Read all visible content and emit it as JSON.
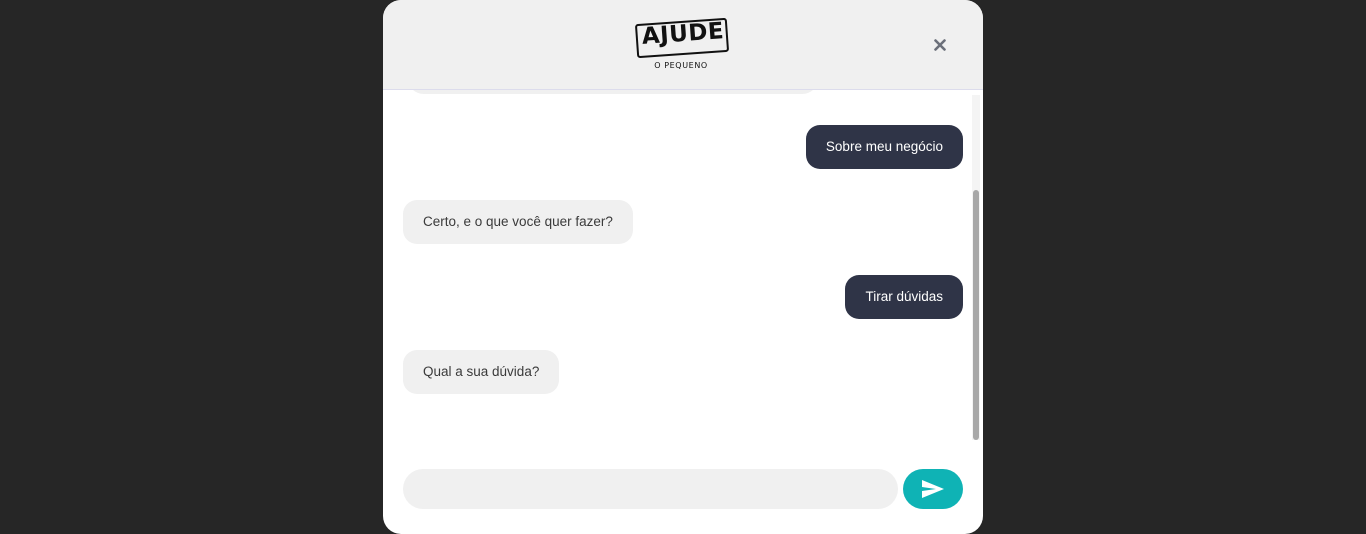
{
  "header": {
    "logo_text": "AJUDE",
    "logo_subtext": "O PEQUENO"
  },
  "messages": [
    {
      "sender": "user",
      "text": "Sobre meu negócio"
    },
    {
      "sender": "bot",
      "text": "Certo, e o que você quer fazer?"
    },
    {
      "sender": "user",
      "text": "Tirar dúvidas"
    },
    {
      "sender": "bot",
      "text": "Qual a sua dúvida?"
    }
  ],
  "input": {
    "value": "",
    "placeholder": ""
  },
  "icons": {
    "close": "close-icon",
    "send": "send-icon"
  },
  "colors": {
    "overlay": "#262626",
    "user_bubble": "#2f3447",
    "bot_bubble": "#f0f0f0",
    "send_button": "#0fb3b5"
  }
}
